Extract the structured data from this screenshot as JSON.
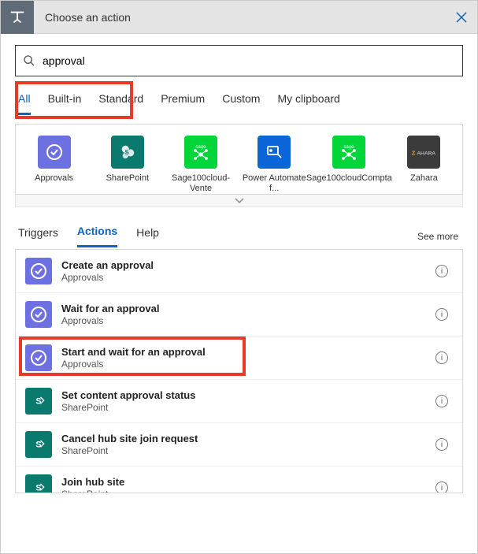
{
  "header": {
    "title": "Choose an action"
  },
  "search": {
    "value": "approval"
  },
  "categoryTabs": [
    "All",
    "Built-in",
    "Standard",
    "Premium",
    "Custom",
    "My clipboard"
  ],
  "activeCategory": 0,
  "connectors": [
    {
      "label": "Approvals",
      "style": "approvals"
    },
    {
      "label": "SharePoint",
      "style": "sharepoint"
    },
    {
      "label": "Sage100cloud-Vente",
      "style": "sage"
    },
    {
      "label": "Power Automate f...",
      "style": "pa"
    },
    {
      "label": "Sage100cloudCompta",
      "style": "sage"
    },
    {
      "label": "Zahara",
      "style": "zahara"
    }
  ],
  "sectionTabs": {
    "triggers": "Triggers",
    "actions": "Actions",
    "help": "Help",
    "seeMore": "See more"
  },
  "activeSection": "actions",
  "actions": [
    {
      "title": "Create an approval",
      "sub": "Approvals",
      "style": "approvals"
    },
    {
      "title": "Wait for an approval",
      "sub": "Approvals",
      "style": "approvals"
    },
    {
      "title": "Start and wait for an approval",
      "sub": "Approvals",
      "style": "approvals",
      "highlighted": true
    },
    {
      "title": "Set content approval status",
      "sub": "SharePoint",
      "style": "sharepoint"
    },
    {
      "title": "Cancel hub site join request",
      "sub": "SharePoint",
      "style": "sharepoint"
    },
    {
      "title": "Join hub site",
      "sub": "SharePoint",
      "style": "sharepoint"
    }
  ]
}
